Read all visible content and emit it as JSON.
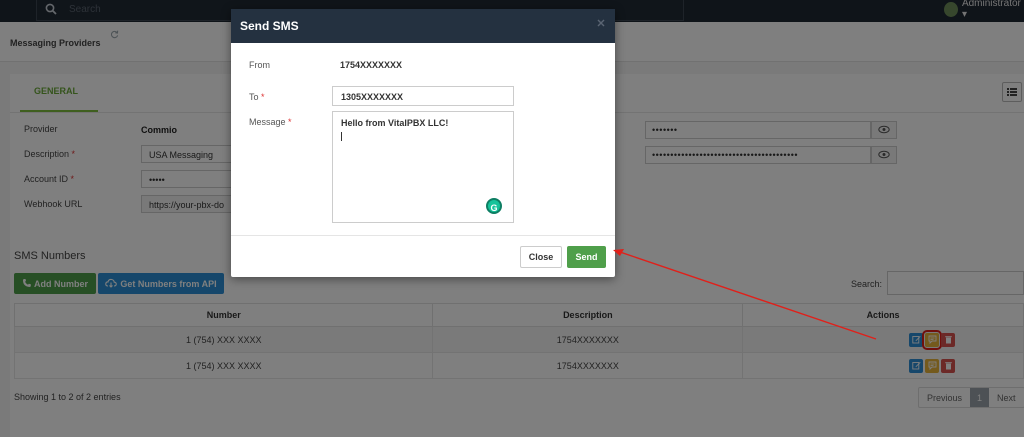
{
  "topbar": {
    "search_placeholder": "Search",
    "user": "Administrator ▾"
  },
  "tabs": {
    "active": "Messaging Providers"
  },
  "panel": {
    "general_tab": "GENERAL"
  },
  "form": {
    "provider": {
      "label": "Provider",
      "value": "Commio"
    },
    "description": {
      "label": "Description",
      "value": "USA Messaging"
    },
    "account_id": {
      "label": "Account ID",
      "value": "•••••"
    },
    "webhook_url": {
      "label": "Webhook URL",
      "value": "https://your-pbx-do"
    },
    "right_secret_1": "•••••••",
    "right_secret_2": "••••••••••••••••••••••••••••••••••••••••"
  },
  "sms_numbers": {
    "title": "SMS Numbers",
    "add_label": "Add Number",
    "get_label": "Get Numbers from API",
    "search_label": "Search:",
    "columns": [
      "Number",
      "Description",
      "Actions"
    ],
    "rows": [
      {
        "number": "1 (754) XXX XXXX",
        "description": "1754XXXXXXX"
      },
      {
        "number": "1 (754) XXX XXXX",
        "description": "1754XXXXXXX"
      }
    ],
    "showing": "Showing 1 to 2 of 2 entries",
    "pager": {
      "prev": "Previous",
      "page": "1",
      "next": "Next"
    }
  },
  "modal": {
    "title": "Send SMS",
    "from_label": "From",
    "from_value": "1754XXXXXXX",
    "to_label": "To",
    "to_value": "1305XXXXXXX",
    "message_label": "Message",
    "message_value": "Hello from VitalPBX LLC!",
    "close_label": "Close",
    "send_label": "Send"
  },
  "colors": {
    "accent_green": "#4f9f4a",
    "accent_blue": "#2c8fd6",
    "annotation_red": "#e0201a"
  },
  "icons": [
    "search-icon",
    "user-avatar",
    "refresh-icon",
    "list-icon",
    "eye-icon",
    "phone-plus-icon",
    "cloud-download-icon",
    "edit-icon",
    "sms-icon",
    "trash-icon",
    "close-icon",
    "grammarly-icon"
  ]
}
